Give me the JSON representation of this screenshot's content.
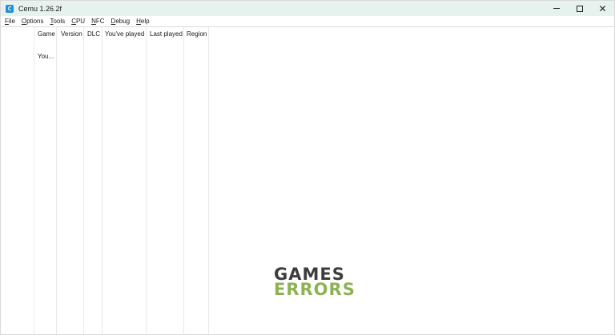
{
  "window": {
    "title": "Cemu 1.26.2f",
    "icon": "cemu-app-icon",
    "controls": [
      "minimize-icon",
      "maximize-icon",
      "close-icon"
    ],
    "close_glyph": "✕"
  },
  "menu": [
    {
      "label_pre": "",
      "accel": "F",
      "label_post": "ile"
    },
    {
      "label_pre": "",
      "accel": "O",
      "label_post": "ptions"
    },
    {
      "label_pre": "",
      "accel": "T",
      "label_post": "ools"
    },
    {
      "label_pre": "",
      "accel": "C",
      "label_post": "PU"
    },
    {
      "label_pre": "",
      "accel": "N",
      "label_post": "FC"
    },
    {
      "label_pre": "",
      "accel": "D",
      "label_post": "ebug"
    },
    {
      "label_pre": "",
      "accel": "H",
      "label_post": "elp"
    }
  ],
  "gamelist": {
    "columns": [
      "Game",
      "Version",
      "DLC",
      "You've played",
      "Last played",
      "Region"
    ],
    "rows": [
      {
        "game": "You..."
      }
    ]
  },
  "watermark": {
    "line1": "GAMES",
    "line2": "ERRORS",
    "colors": {
      "line1": "#3d3d3d",
      "line2": "#8cb352"
    }
  },
  "colors": {
    "titlebar": "#e6f2ee",
    "accent": "#1f8fd6"
  }
}
